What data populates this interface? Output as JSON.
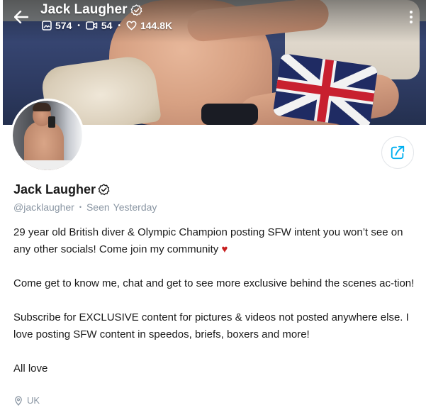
{
  "header": {
    "name": "Jack Laugher",
    "stats": {
      "photos": "574",
      "videos": "54",
      "likes": "144.8K"
    }
  },
  "profile": {
    "name": "Jack Laugher",
    "handle": "@jacklaugher",
    "seen_label": "Seen",
    "seen_value": "Yesterday",
    "bio": {
      "p1": "29 year old British diver & Olympic Champion posting SFW intent you won’t see on any other socials! Come join my community",
      "p1_heart": "♥",
      "p2": "Come get to know me, chat and get to see more exclusive behind the scenes ac-tion!",
      "p3": "Subscribe for EXCLUSIVE content for pictures & videos not posted anywhere else. I love posting SFW content in speedos, briefs, boxers and more!",
      "p4": "All love"
    },
    "location": "UK"
  },
  "icons": {
    "back": "arrow-left-icon",
    "verified": "verified-badge-icon",
    "photos": "image-icon",
    "videos": "video-icon",
    "likes": "heart-icon",
    "more": "more-vertical-icon",
    "share": "share-icon",
    "location": "location-pin-icon"
  },
  "colors": {
    "accent": "#00aff0",
    "muted": "#8a96a3",
    "text": "#1a1a1a",
    "heart": "#c71f1f"
  }
}
